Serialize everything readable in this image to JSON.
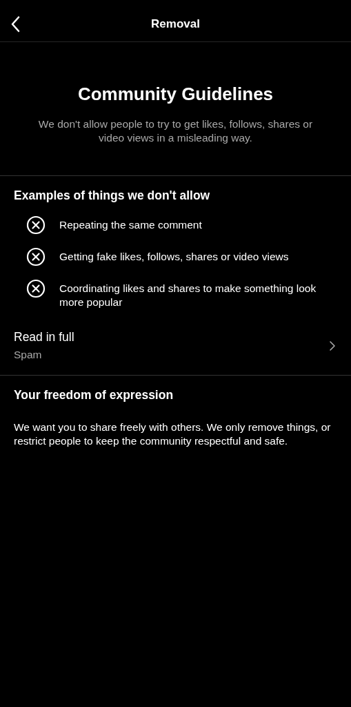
{
  "header": {
    "title": "Removal"
  },
  "intro": {
    "title": "Community Guidelines",
    "text": "We don't allow people to try to get likes, follows, shares or video views in a misleading way."
  },
  "examples": {
    "heading": "Examples of things we don't allow",
    "items": [
      {
        "text": "Repeating the same comment"
      },
      {
        "text": "Getting fake likes, follows, shares or video views"
      },
      {
        "text": "Coordinating likes and shares to make something look more popular"
      }
    ]
  },
  "read_more": {
    "label": "Read in full",
    "sublabel": "Spam"
  },
  "freedom": {
    "heading": "Your freedom of expression",
    "text": "We want you to share freely with others. We only remove things, or restrict people to keep the community respectful and safe."
  }
}
